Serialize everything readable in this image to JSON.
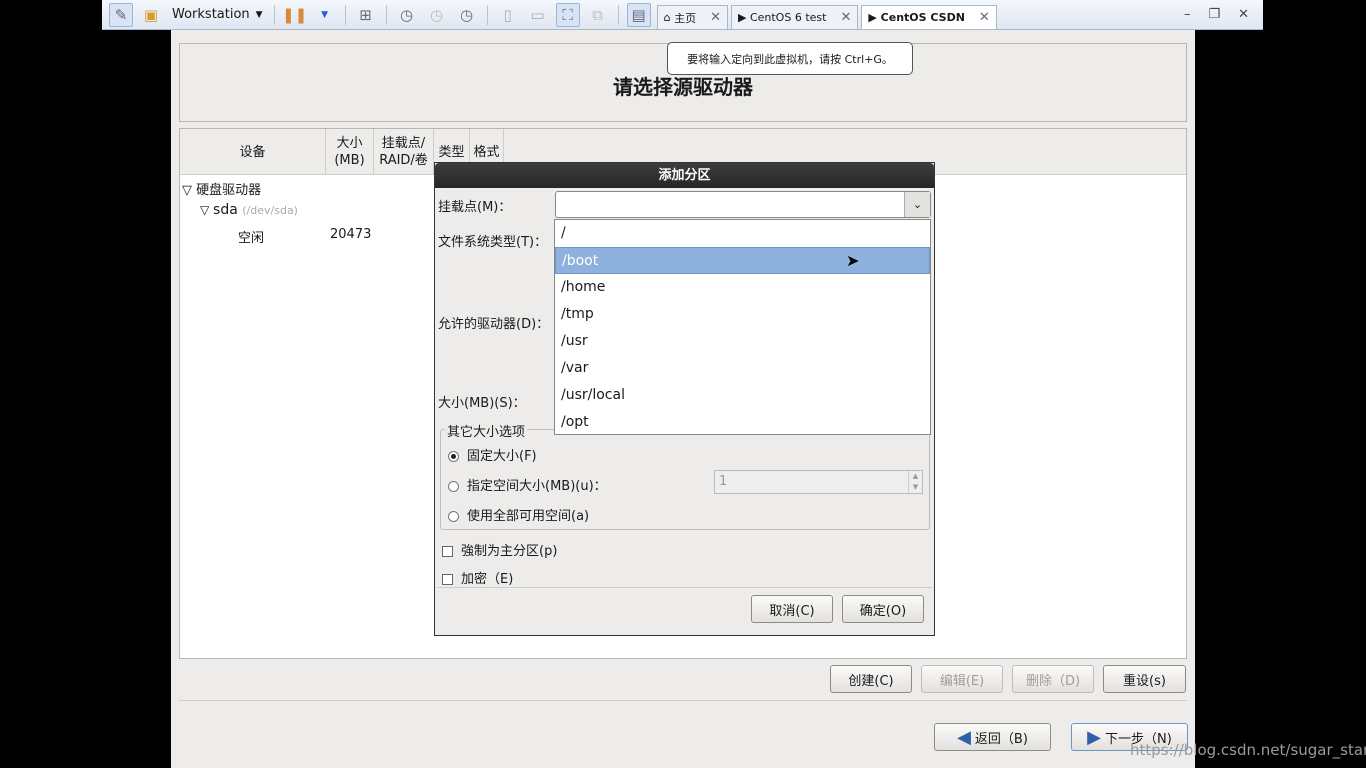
{
  "vmware": {
    "product": "Workstation",
    "tabs": [
      {
        "label": "主页"
      },
      {
        "label": "CentOS 6 test"
      },
      {
        "label": "CentOS CSDN",
        "active": true
      }
    ],
    "tooltip": "要将输入定向到此虚拟机，请按 Ctrl+G。"
  },
  "installer": {
    "title": "请选择源驱动器",
    "columns": [
      "设备",
      "大小\n(MB)",
      "挂载点/\nRAID/卷",
      "类型",
      "格式"
    ],
    "tree": {
      "group": "硬盘驱动器",
      "disk": "sda",
      "disk_path": "(/dev/sda)",
      "free_label": "空闲",
      "free_size": "20473"
    },
    "buttons": {
      "create": "创建(C)",
      "edit": "编辑(E)",
      "delete": "删除（D)",
      "reset": "重设(s)"
    },
    "nav": {
      "back": "返回（B)",
      "next": "下一步（N)"
    }
  },
  "dialog": {
    "title": "添加分区",
    "mount_label": "挂载点(M)：",
    "mount_value": "",
    "fstype_label": "文件系统类型(T)：",
    "drives_label": "允许的驱动器(D)：",
    "size_label": "大小(MB)(S)：",
    "options_legend": "其它大小选项",
    "opt_fixed": "固定大小(F)",
    "opt_upto": "指定空间大小(MB)(u)：",
    "opt_upto_value": "1",
    "opt_fill": "使用全部可用空间(a)",
    "primary": "強制为主分区(p)",
    "encrypt": "加密（E)",
    "cancel": "取消(C)",
    "ok": "确定(O)",
    "mount_options": [
      "/",
      "/boot",
      "/home",
      "/tmp",
      "/usr",
      "/var",
      "/usr/local",
      "/opt"
    ],
    "selected_option": "/boot"
  },
  "watermark": "https://blog.csdn.net/sugar_star"
}
